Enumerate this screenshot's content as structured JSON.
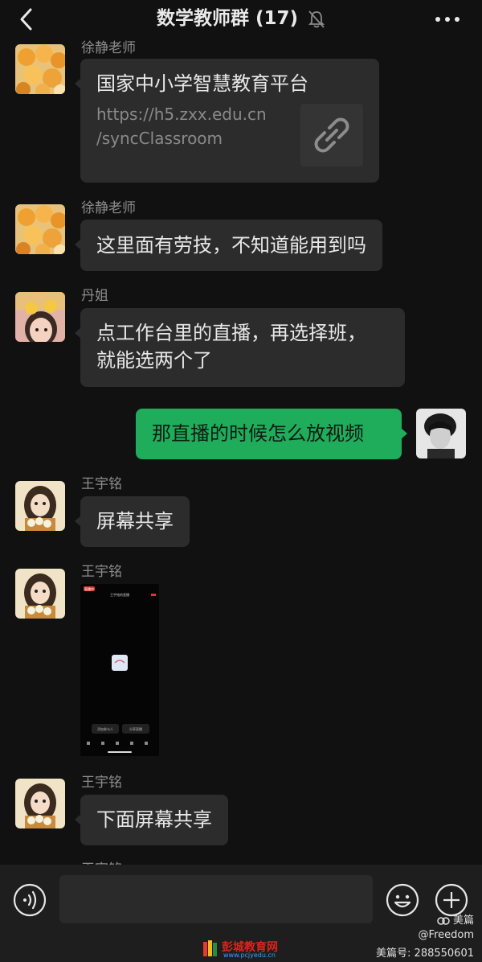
{
  "header": {
    "title": "数学教师群",
    "count": "(17)",
    "colors": {
      "background": "#111111",
      "text": "#e9e9e9"
    }
  },
  "messages": [
    {
      "type": "link",
      "sender": "徐静老师",
      "title": "国家中小学智慧教育平台",
      "url_line1": "https://h5.zxx.edu.cn",
      "url_line2": "/syncClassroom",
      "icon": "link-icon"
    },
    {
      "type": "text",
      "sender": "徐静老师",
      "text": "这里面有劳技，不知道能用到吗"
    },
    {
      "type": "text",
      "sender": "丹姐",
      "line1": "点工作台里的直播，再选择班，",
      "line2": "就能选两个了"
    },
    {
      "type": "text",
      "sender": "me",
      "text": "那直播的时候怎么放视频"
    },
    {
      "type": "text",
      "sender": "王宇铭",
      "text": "屏幕共享"
    },
    {
      "type": "image",
      "sender": "王宇铭",
      "screenshot": {
        "live_badge": "直播中",
        "title": "王宇铭的直播",
        "left_button": "添加参与人",
        "right_button": "分享直播"
      }
    },
    {
      "type": "text",
      "sender": "王宇铭",
      "text": "下面屏幕共享"
    }
  ],
  "partial_sender": "王宇铭",
  "input": {
    "placeholder": "",
    "value": ""
  },
  "watermark": {
    "meipian": "美篇",
    "user": "@Freedom",
    "number": "美篇号: 288550601",
    "site": "彭城教育网",
    "site_url": "www.pcjyedu.cn"
  },
  "colors": {
    "bubble_other": "#2c2c2c",
    "bubble_mine": "#1fad5c",
    "bottom_bar": "#1e1e1e"
  }
}
